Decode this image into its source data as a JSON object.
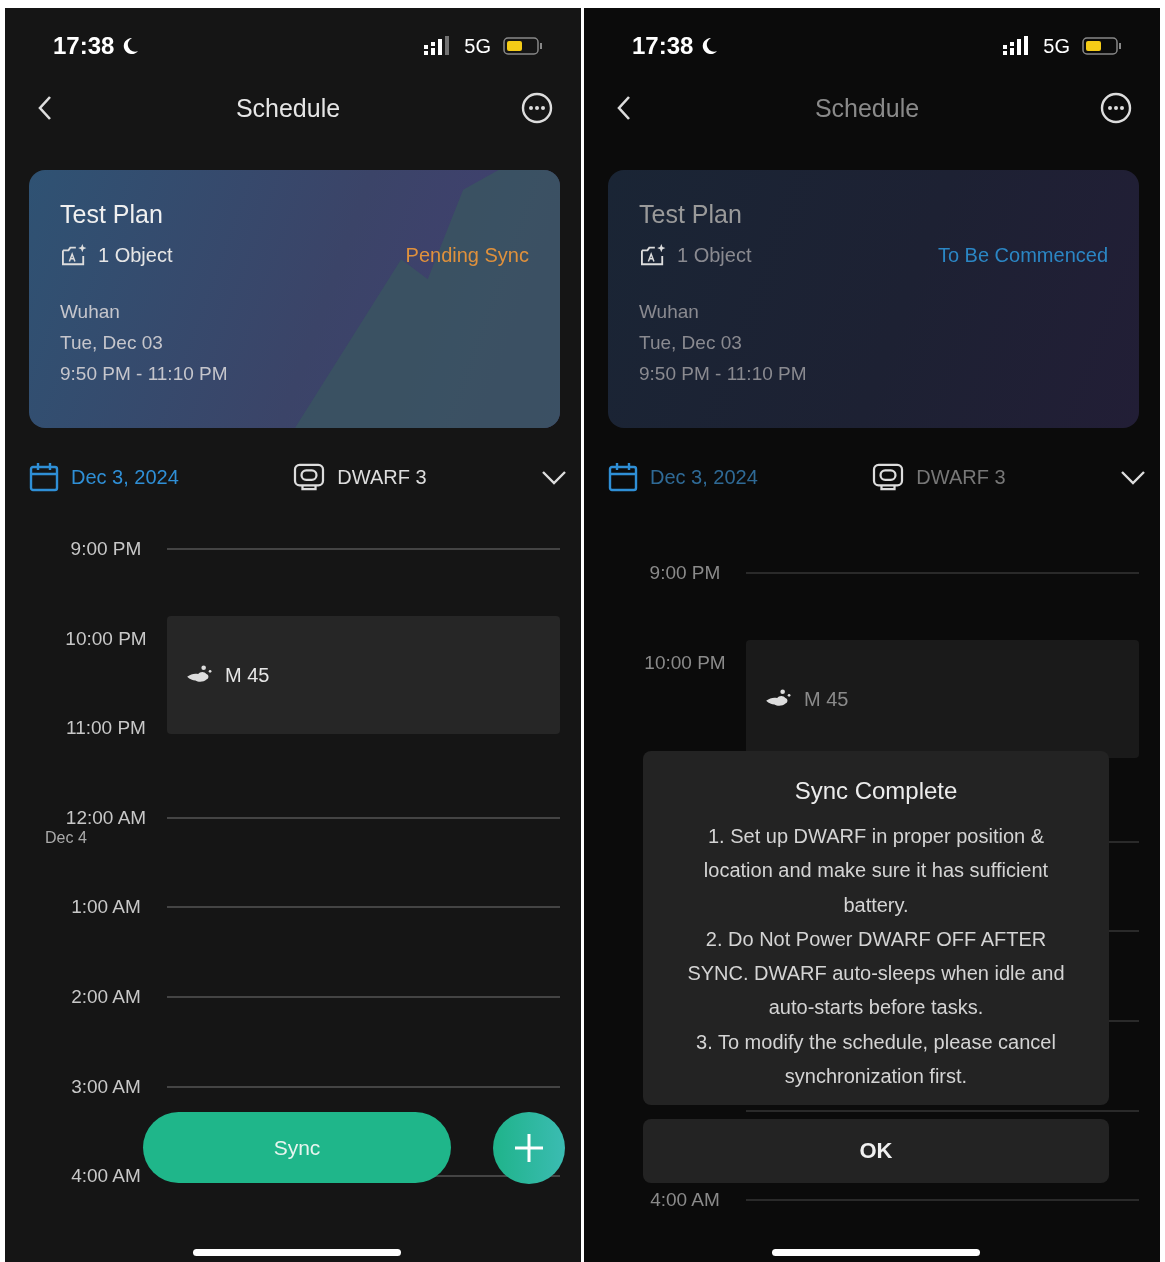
{
  "screens": [
    {
      "dimmed": false,
      "status_bar": {
        "time": "17:38",
        "network": "5G"
      },
      "nav": {
        "title": "Schedule"
      },
      "card": {
        "title": "Test Plan",
        "objects": "1 Object",
        "status": {
          "text": "Pending Sync",
          "color": "#e0913c"
        },
        "location": "Wuhan",
        "date": "Tue, Dec 03",
        "time_range": "9:50 PM - 11:10 PM"
      },
      "filter": {
        "date": "Dec 3, 2024",
        "device": "DWARF 3"
      },
      "hours": [
        {
          "kind": "labeled",
          "time": "9:00 PM"
        },
        {
          "kind": "labeled",
          "time": "10:00 PM"
        },
        {
          "kind": "labeled",
          "time": "11:00 PM"
        },
        {
          "kind": "labeled",
          "time": "12:00 AM",
          "sub": "Dec 4"
        },
        {
          "kind": "labeled",
          "time": "1:00 AM"
        },
        {
          "kind": "labeled",
          "time": "2:00 AM"
        },
        {
          "kind": "labeled",
          "time": "3:00 AM"
        },
        {
          "kind": "labeled",
          "time": "4:00 AM"
        }
      ],
      "event": {
        "name": "M 45"
      },
      "sync_button": {
        "label": "Sync"
      }
    },
    {
      "dimmed": true,
      "status_bar": {
        "time": "17:38",
        "network": "5G"
      },
      "nav": {
        "title": "Schedule"
      },
      "card": {
        "title": "Test Plan",
        "objects": "1 Object",
        "status": {
          "text": "To Be Commenced",
          "color": "#2b86c4"
        },
        "location": "Wuhan",
        "date": "Tue, Dec 03",
        "time_range": "9:50 PM - 11:10 PM"
      },
      "filter": {
        "date": "Dec 3, 2024",
        "device": "DWARF 3"
      },
      "hours": [
        {
          "kind": "labeled",
          "time": "9:00 PM"
        },
        {
          "kind": "labeled",
          "time": "10:00 PM"
        },
        {
          "kind": "covered"
        },
        {
          "kind": "covered"
        },
        {
          "kind": "covered"
        },
        {
          "kind": "covered"
        },
        {
          "kind": "covered"
        },
        {
          "kind": "labeled",
          "time": "4:00 AM"
        }
      ],
      "event": {
        "name": "M 45"
      },
      "dialog": {
        "title": "Sync Complete",
        "lines": [
          "1. Set up DWARF in proper position & location and make sure it has sufficient battery.",
          "2. Do Not Power DWARF OFF AFTER SYNC. DWARF auto-sleeps when idle and auto-starts before tasks.",
          "3. To modify the schedule, please cancel synchronization first."
        ],
        "button": "OK"
      }
    }
  ]
}
